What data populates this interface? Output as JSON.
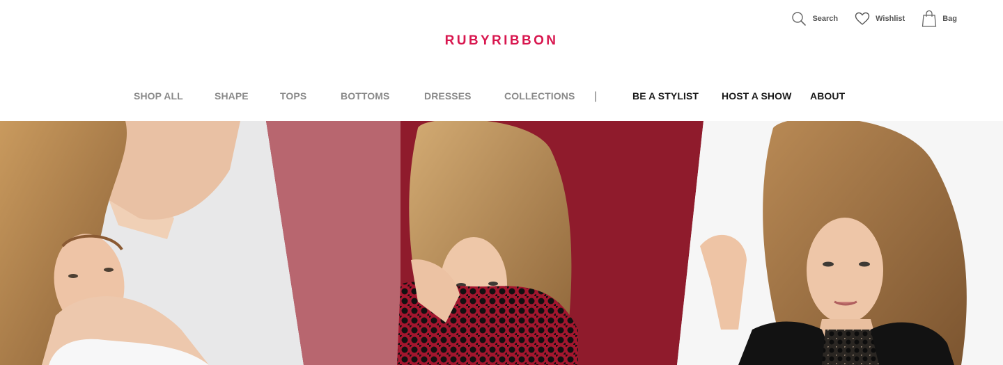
{
  "brand": {
    "logo_text": "RUBYRIBBON",
    "accent_color": "#d8174f"
  },
  "utility_nav": [
    {
      "label": "Search",
      "icon": "search-icon"
    },
    {
      "label": "Wishlist",
      "icon": "heart-icon"
    },
    {
      "label": "Bag",
      "icon": "shopping-bag-icon"
    }
  ],
  "main_nav": [
    "SHOP ALL",
    "SHAPE",
    "TOPS",
    "BOTTOMS",
    "DRESSES",
    "COLLECTIONS"
  ],
  "separator": "|",
  "secondary_nav": [
    "BE A STYLIST",
    "HOST A SHOW",
    "ABOUT"
  ],
  "hero": {
    "panels": [
      {
        "name": "white-top-model",
        "background": "#e9e9ea"
      },
      {
        "name": "red-lace-model",
        "background": "#8f1b2c"
      },
      {
        "name": "black-blazer-model",
        "background": "#f6f6f6"
      }
    ]
  }
}
